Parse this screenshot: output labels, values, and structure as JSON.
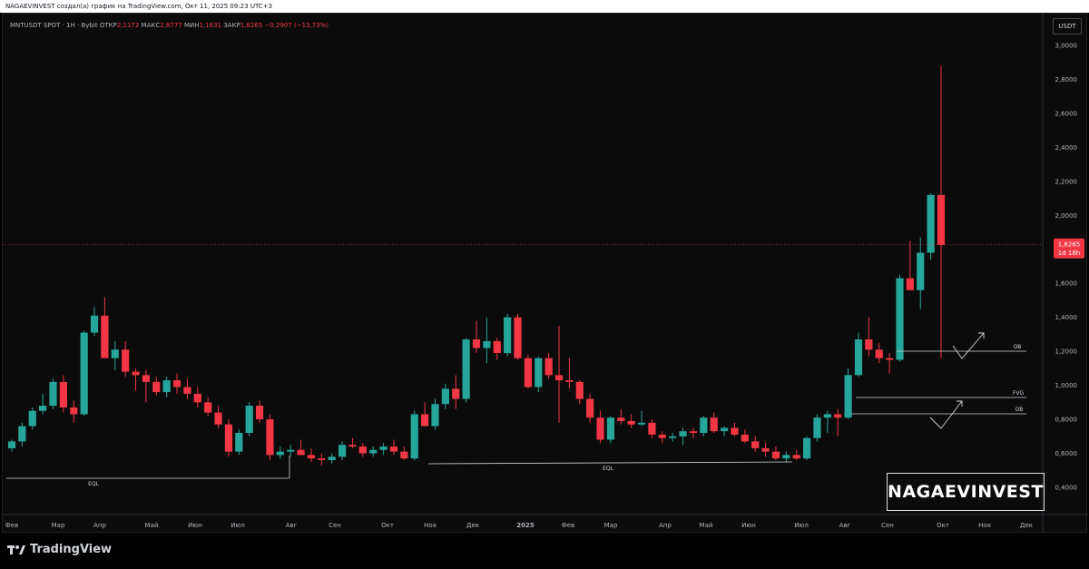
{
  "header": {
    "text": "NAGAEVINVEST создал(а) график на TradingView.com, Окт 11, 2025 09:23 UTC+3"
  },
  "legend": {
    "symbol": "MNTUSDT SPOT · 1H · Bybit",
    "open_label": "ОТКР",
    "open_value": "2,1172",
    "high_label": "МАКС",
    "high_value": "2,8777",
    "low_label": "МИН",
    "low_value": "1,1631",
    "close_label": "ЗАКР",
    "close_value": "1,8265",
    "change": "−0,2907 (−13,73%)"
  },
  "currency": "USDT",
  "watermark": "NAGAEVINVEST",
  "brand": "TradingView",
  "price_label": {
    "value": "1,8265",
    "sub": "1d 18h"
  },
  "colors": {
    "up": "#26a69a",
    "down": "#f23645",
    "background": "#0b0b0b"
  },
  "chart_data": {
    "type": "candlestick",
    "ylim": [
      0.3,
      3.05
    ],
    "y_ticks": [
      "0,4000",
      "0,6000",
      "0,8000",
      "1,0000",
      "1,2000",
      "1,4000",
      "1,6000",
      "1,8000",
      "2,0000",
      "2,2000",
      "2,4000",
      "2,6000",
      "2,8000",
      "3,0000"
    ],
    "x_labels": [
      "Фев",
      "Мар",
      "Апр",
      "Май",
      "Июн",
      "Июл",
      "Авг",
      "Сен",
      "Окт",
      "Ноя",
      "Дек",
      "2025",
      "Фев",
      "Мар",
      "Апр",
      "Май",
      "Июн",
      "Июл",
      "Авг",
      "Сен",
      "Окт",
      "Ноя",
      "Дек"
    ],
    "last_price": 1.8265,
    "candles": [
      [
        0.63,
        0.68,
        0.61,
        0.67
      ],
      [
        0.67,
        0.78,
        0.64,
        0.76
      ],
      [
        0.76,
        0.87,
        0.74,
        0.85
      ],
      [
        0.85,
        0.95,
        0.83,
        0.88
      ],
      [
        0.88,
        1.04,
        0.86,
        1.02
      ],
      [
        1.02,
        1.06,
        0.84,
        0.87
      ],
      [
        0.87,
        0.91,
        0.78,
        0.83
      ],
      [
        0.83,
        1.32,
        0.82,
        1.31
      ],
      [
        1.31,
        1.46,
        1.29,
        1.41
      ],
      [
        1.41,
        1.52,
        1.19,
        1.16
      ],
      [
        1.16,
        1.26,
        1.09,
        1.21
      ],
      [
        1.21,
        1.26,
        1.05,
        1.08
      ],
      [
        1.08,
        1.1,
        0.97,
        1.06
      ],
      [
        1.06,
        1.09,
        0.9,
        1.02
      ],
      [
        1.02,
        1.05,
        0.94,
        0.96
      ],
      [
        0.96,
        1.05,
        0.93,
        1.03
      ],
      [
        1.03,
        1.07,
        0.95,
        0.99
      ],
      [
        0.99,
        1.04,
        0.92,
        0.95
      ],
      [
        0.95,
        0.99,
        0.87,
        0.9
      ],
      [
        0.9,
        0.93,
        0.82,
        0.84
      ],
      [
        0.84,
        0.88,
        0.75,
        0.77
      ],
      [
        0.77,
        0.8,
        0.58,
        0.61
      ],
      [
        0.61,
        0.74,
        0.59,
        0.72
      ],
      [
        0.72,
        0.9,
        0.7,
        0.88
      ],
      [
        0.88,
        0.91,
        0.78,
        0.8
      ],
      [
        0.8,
        0.83,
        0.56,
        0.59
      ],
      [
        0.59,
        0.64,
        0.57,
        0.61
      ],
      [
        0.61,
        0.65,
        0.58,
        0.62
      ],
      [
        0.62,
        0.68,
        0.59,
        0.59
      ],
      [
        0.59,
        0.63,
        0.55,
        0.57
      ],
      [
        0.57,
        0.6,
        0.53,
        0.56
      ],
      [
        0.56,
        0.6,
        0.54,
        0.58
      ],
      [
        0.58,
        0.67,
        0.56,
        0.65
      ],
      [
        0.65,
        0.69,
        0.63,
        0.64
      ],
      [
        0.64,
        0.66,
        0.58,
        0.6
      ],
      [
        0.6,
        0.64,
        0.58,
        0.62
      ],
      [
        0.62,
        0.66,
        0.59,
        0.64
      ],
      [
        0.64,
        0.68,
        0.59,
        0.61
      ],
      [
        0.61,
        0.64,
        0.56,
        0.57
      ],
      [
        0.57,
        0.85,
        0.56,
        0.83
      ],
      [
        0.83,
        0.9,
        0.78,
        0.76
      ],
      [
        0.76,
        0.92,
        0.74,
        0.89
      ],
      [
        0.89,
        1.01,
        0.86,
        0.98
      ],
      [
        0.98,
        1.06,
        0.86,
        0.92
      ],
      [
        0.92,
        1.28,
        0.9,
        1.27
      ],
      [
        1.27,
        1.38,
        1.19,
        1.22
      ],
      [
        1.22,
        1.4,
        1.13,
        1.26
      ],
      [
        1.26,
        1.28,
        1.15,
        1.19
      ],
      [
        1.19,
        1.42,
        1.17,
        1.4
      ],
      [
        1.4,
        1.42,
        1.15,
        1.16
      ],
      [
        1.16,
        1.18,
        0.98,
        0.99
      ],
      [
        0.99,
        1.17,
        0.96,
        1.16
      ],
      [
        1.16,
        1.19,
        1.04,
        1.06
      ],
      [
        1.06,
        1.35,
        0.78,
        1.03
      ],
      [
        1.03,
        1.16,
        0.98,
        1.02
      ],
      [
        1.02,
        1.03,
        0.89,
        0.92
      ],
      [
        0.92,
        0.95,
        0.78,
        0.81
      ],
      [
        0.81,
        0.85,
        0.66,
        0.68
      ],
      [
        0.68,
        0.82,
        0.66,
        0.81
      ],
      [
        0.81,
        0.86,
        0.77,
        0.79
      ],
      [
        0.79,
        0.83,
        0.75,
        0.77
      ],
      [
        0.77,
        0.85,
        0.76,
        0.78
      ],
      [
        0.78,
        0.8,
        0.69,
        0.71
      ],
      [
        0.71,
        0.73,
        0.66,
        0.69
      ],
      [
        0.69,
        0.72,
        0.67,
        0.7
      ],
      [
        0.7,
        0.75,
        0.65,
        0.73
      ],
      [
        0.73,
        0.75,
        0.69,
        0.72
      ],
      [
        0.72,
        0.82,
        0.7,
        0.81
      ],
      [
        0.81,
        0.84,
        0.72,
        0.73
      ],
      [
        0.73,
        0.76,
        0.7,
        0.75
      ],
      [
        0.75,
        0.78,
        0.7,
        0.71
      ],
      [
        0.71,
        0.74,
        0.66,
        0.67
      ],
      [
        0.67,
        0.7,
        0.61,
        0.63
      ],
      [
        0.63,
        0.66,
        0.58,
        0.61
      ],
      [
        0.61,
        0.64,
        0.56,
        0.57
      ],
      [
        0.57,
        0.61,
        0.55,
        0.59
      ],
      [
        0.59,
        0.62,
        0.56,
        0.57
      ],
      [
        0.57,
        0.7,
        0.56,
        0.69
      ],
      [
        0.69,
        0.83,
        0.67,
        0.81
      ],
      [
        0.81,
        0.85,
        0.72,
        0.83
      ],
      [
        0.83,
        0.86,
        0.7,
        0.81
      ],
      [
        0.81,
        1.1,
        0.8,
        1.06
      ],
      [
        1.06,
        1.31,
        1.05,
        1.27
      ],
      [
        1.27,
        1.4,
        1.17,
        1.21
      ],
      [
        1.21,
        1.25,
        1.13,
        1.16
      ],
      [
        1.16,
        1.19,
        1.07,
        1.15
      ],
      [
        1.15,
        1.65,
        1.14,
        1.63
      ],
      [
        1.63,
        1.85,
        1.58,
        1.56
      ],
      [
        1.56,
        1.87,
        1.45,
        1.78
      ],
      [
        1.78,
        2.13,
        1.74,
        2.12
      ],
      [
        2.12,
        2.88,
        1.16,
        1.8265
      ]
    ],
    "annotations": [
      {
        "label": "EQL"
      },
      {
        "label": "EQL"
      },
      {
        "label": "OB"
      },
      {
        "label": "FVG"
      },
      {
        "label": "OB"
      }
    ]
  }
}
